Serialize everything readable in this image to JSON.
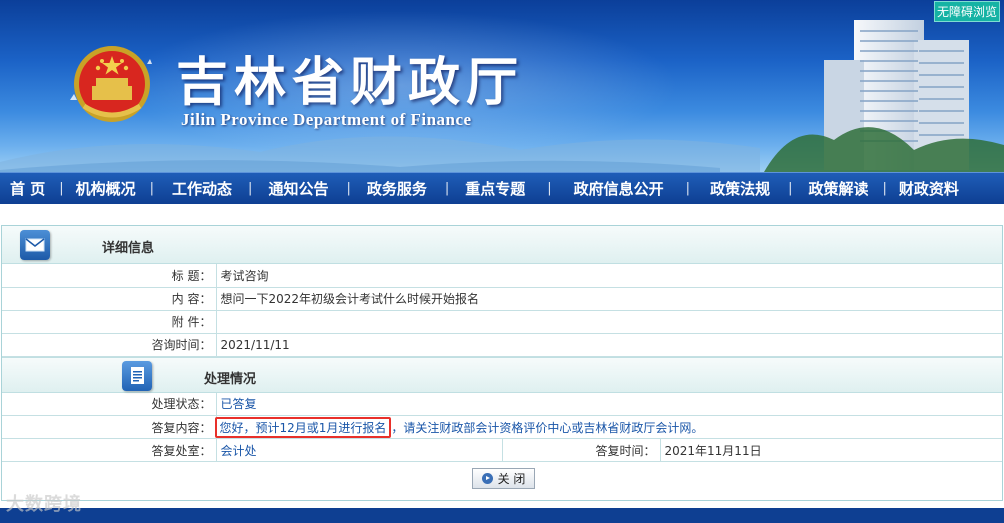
{
  "header": {
    "title_cn": "吉林省财政厅",
    "title_en": "Jilin Province Department of Finance",
    "accessibility_label": "无障碍浏览"
  },
  "nav": {
    "items": [
      "首 页",
      "机构概况",
      "工作动态",
      "通知公告",
      "政务服务",
      "重点专题",
      "政府信息公开",
      "政策法规",
      "政策解读",
      "财政资料"
    ]
  },
  "detail": {
    "section_title": "详细信息",
    "rows": [
      {
        "label": "标  题：",
        "value": "考试咨询"
      },
      {
        "label": "内  容：",
        "value": "想问一下2022年初级会计考试什么时候开始报名"
      },
      {
        "label": "附  件：",
        "value": ""
      },
      {
        "label": "咨询时间：",
        "value": "2021/11/11"
      }
    ]
  },
  "processing": {
    "section_title": "处理情况",
    "status_label": "处理状态：",
    "status_value": "已答复",
    "reply_label": "答复内容：",
    "reply_highlight": "您好，预计12月或1月进行报名",
    "reply_rest": "，请关注财政部会计资格评价中心或吉林省财政厅会计网。",
    "office_label": "答复处室：",
    "office_value": "会计处",
    "time_label": "答复时间：",
    "time_value": "2021年11月11日"
  },
  "actions": {
    "close_label": "关 闭"
  },
  "watermark": "大数跨境",
  "colors": {
    "nav_bg": "#0e3f92",
    "highlight_border": "#e8302a",
    "accessibility_bg": "#16b3a4",
    "reply_text": "#1a56a8"
  }
}
